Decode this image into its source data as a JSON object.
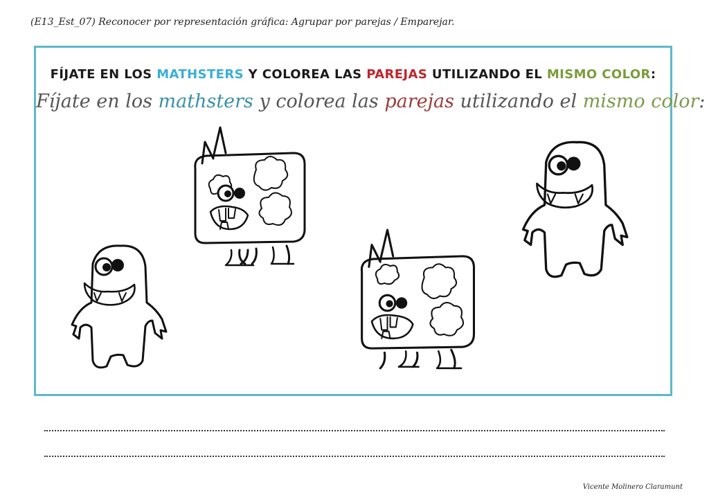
{
  "header": {
    "code_line": "(E13_Est_07) Reconocer por representación gráfica: Agrupar por parejas / Emparejar."
  },
  "instructions": {
    "caps": {
      "part1": "FÍJATE EN LOS ",
      "mathsters": "MATHSTERS",
      "part2": " Y COLOREA LAS ",
      "parejas": "PAREJAS",
      "part3": " UTILIZANDO EL ",
      "mismo_color": "MISMO COLOR",
      "part4": ":"
    },
    "script": {
      "part1": "Fíjate en los ",
      "mathsters": "mathsters",
      "part2": " y colorea las ",
      "parejas": "parejas",
      "part3": " utilizando el ",
      "mismo_color": "mismo color",
      "part4": ":"
    }
  },
  "monsters": [
    {
      "kind": "square-horned-monster"
    },
    {
      "kind": "round-ghost-monster"
    },
    {
      "kind": "square-horned-monster"
    },
    {
      "kind": "round-ghost-monster"
    }
  ],
  "answer_lines": 2,
  "footer": {
    "author": "Vicente Molinero Claramunt"
  },
  "colors": {
    "frame": "#5cbac6",
    "mathsters": "#3aaed8",
    "parejas": "#c0252b",
    "mismo_color": "#7a9c3a"
  }
}
